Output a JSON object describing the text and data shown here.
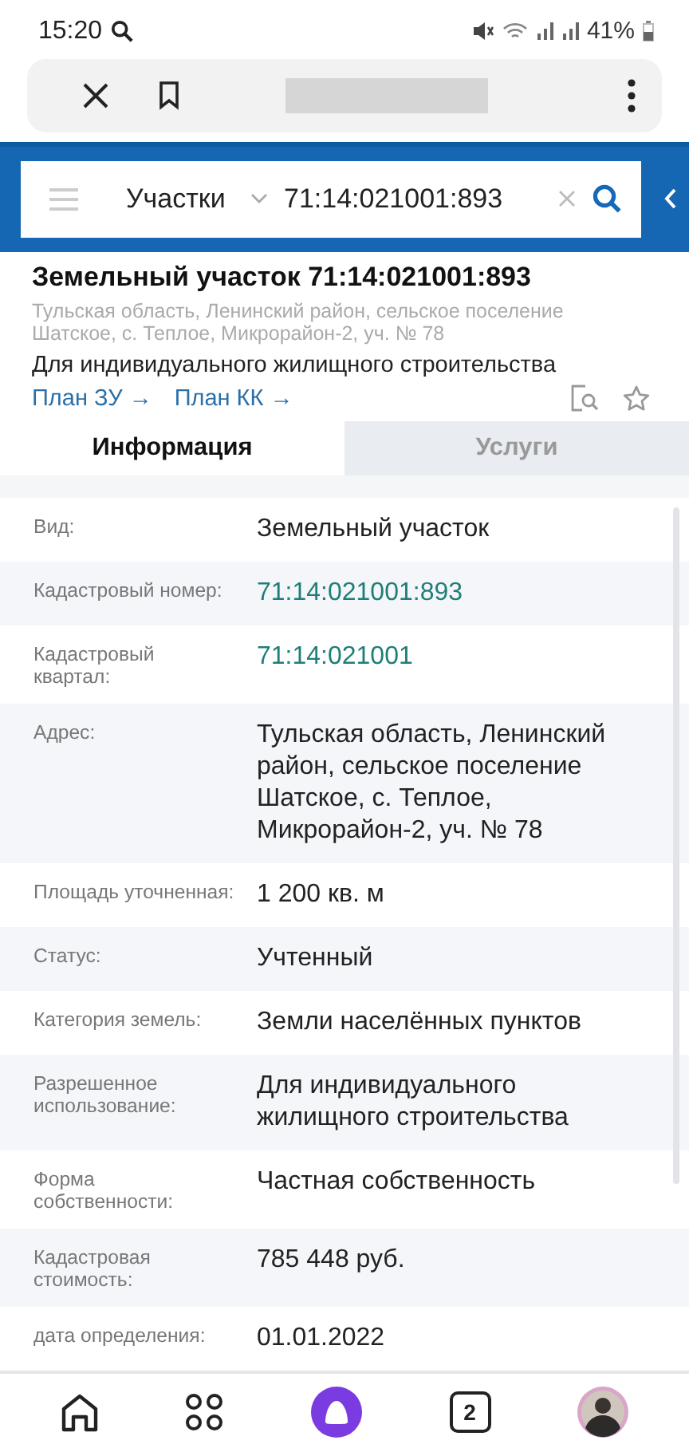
{
  "status_bar": {
    "time": "15:20",
    "battery": "41%"
  },
  "search": {
    "category": "Участки",
    "query": "71:14:021001:893"
  },
  "object": {
    "title": "Земельный участок 71:14:021001:893",
    "address": "Тульская область, Ленинский район, сельское поселение Шатское, с. Теплое, Микрорайон-2, уч. № 78",
    "purpose": "Для индивидуального жилищного строительства",
    "links": [
      "План ЗУ →",
      "План КК →"
    ]
  },
  "tabs": [
    {
      "label": "Информация",
      "selected": true
    },
    {
      "label": "Услуги",
      "selected": false
    }
  ],
  "rows": [
    {
      "label": "Вид:",
      "value": "Земельный участок",
      "kind": "text"
    },
    {
      "label": "Кадастровый номер:",
      "value": "71:14:021001:893",
      "kind": "link"
    },
    {
      "label": "Кадастровый квартал:",
      "value": "71:14:021001",
      "kind": "link"
    },
    {
      "label": "Адрес:",
      "value": "Тульская область, Ленинский район, сельское поселение Шатское, с. Теплое, Микрорайон-2, уч. № 78",
      "kind": "text"
    },
    {
      "label": "Площадь уточненная:",
      "value": "1 200 кв. м",
      "kind": "text"
    },
    {
      "label": "Статус:",
      "value": "Учтенный",
      "kind": "text"
    },
    {
      "label": "Категория земель:",
      "value": "Земли населённых пунктов",
      "kind": "text"
    },
    {
      "label": "Разрешенное использование:",
      "value": "Для индивидуального жилищного строительства",
      "kind": "text"
    },
    {
      "label": "Форма собственности:",
      "value": "Частная собственность",
      "kind": "text"
    },
    {
      "label": "Кадастровая стоимость:",
      "value": "785 448 руб.",
      "kind": "text"
    },
    {
      "label": "дата определения:",
      "value": "01.01.2022",
      "kind": "text"
    }
  ],
  "bottom_nav": {
    "tab_count": "2"
  }
}
